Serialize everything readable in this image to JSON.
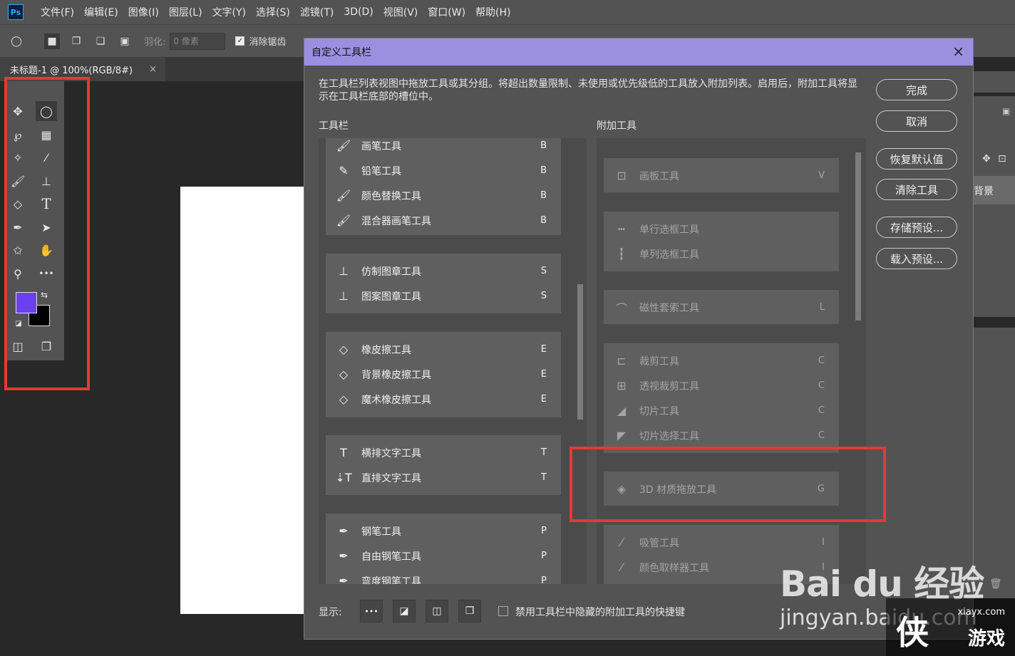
{
  "app": {
    "logo": "Ps",
    "menu": [
      "文件(F)",
      "编辑(E)",
      "图像(I)",
      "图层(L)",
      "文字(Y)",
      "选择(S)",
      "滤镜(T)",
      "3D(D)",
      "视图(V)",
      "窗口(W)",
      "帮助(H)"
    ]
  },
  "options_bar": {
    "feather_label": "羽化:",
    "feather_value": "0 像素",
    "antialias_label": "消除锯齿"
  },
  "document_tab": {
    "title": "未标题-1 @ 100%(RGB/8#)",
    "close": "×"
  },
  "toolbar": {
    "type_tool_glyph": "T",
    "more_glyph": "•••"
  },
  "dialog": {
    "title": "自定义工具栏",
    "close": "×",
    "description": "在工具栏列表视图中拖放工具或其分组。将超出数量限制、未使用或优先级低的工具放入附加列表。启用后，附加工具将显示在工具栏底部的槽位中。",
    "toolbar_title": "工具栏",
    "extra_title": "附加工具",
    "buttons": {
      "done": "完成",
      "cancel": "取消",
      "restore": "恢复默认值",
      "clear": "清除工具",
      "save": "存储预设...",
      "load": "载入预设..."
    },
    "footer": {
      "show_label": "显示:",
      "more_glyph": "•••",
      "checkbox_label": "禁用工具栏中隐藏的附加工具的快捷键"
    },
    "toolbar_groups": [
      {
        "tools": [
          {
            "name": "画笔工具",
            "key": "B",
            "icon": "brush-icon",
            "glyph": "🖌"
          },
          {
            "name": "铅笔工具",
            "key": "B",
            "icon": "pencil-icon",
            "glyph": "✎"
          },
          {
            "name": "颜色替换工具",
            "key": "B",
            "icon": "color-replace-icon",
            "glyph": "🖌"
          },
          {
            "name": "混合器画笔工具",
            "key": "B",
            "icon": "mixer-brush-icon",
            "glyph": "🖌"
          }
        ]
      },
      {
        "tools": [
          {
            "name": "仿制图章工具",
            "key": "S",
            "icon": "clone-stamp-icon",
            "glyph": "⊥"
          },
          {
            "name": "图案图章工具",
            "key": "S",
            "icon": "pattern-stamp-icon",
            "glyph": "⊥"
          }
        ]
      },
      {
        "tools": [
          {
            "name": "橡皮擦工具",
            "key": "E",
            "icon": "eraser-icon",
            "glyph": "◇"
          },
          {
            "name": "背景橡皮擦工具",
            "key": "E",
            "icon": "bg-eraser-icon",
            "glyph": "◇"
          },
          {
            "name": "魔术橡皮擦工具",
            "key": "E",
            "icon": "magic-eraser-icon",
            "glyph": "◇"
          }
        ]
      },
      {
        "tools": [
          {
            "name": "横排文字工具",
            "key": "T",
            "icon": "horizontal-type-icon",
            "glyph": "T"
          },
          {
            "name": "直排文字工具",
            "key": "T",
            "icon": "vertical-type-icon",
            "glyph": "⇣T"
          }
        ]
      },
      {
        "tools": [
          {
            "name": "钢笔工具",
            "key": "P",
            "icon": "pen-icon",
            "glyph": "✒"
          },
          {
            "name": "自由钢笔工具",
            "key": "P",
            "icon": "freeform-pen-icon",
            "glyph": "✒"
          },
          {
            "name": "弯度钢笔工具",
            "key": "P",
            "icon": "curvature-pen-icon",
            "glyph": "✒"
          }
        ]
      }
    ],
    "extra_groups": [
      {
        "tools": [
          {
            "name": "画板工具",
            "key": "V",
            "icon": "artboard-icon",
            "glyph": "⊡"
          }
        ]
      },
      {
        "tools": [
          {
            "name": "单行选框工具",
            "key": "",
            "icon": "single-row-marquee-icon",
            "glyph": "┅"
          },
          {
            "name": "单列选框工具",
            "key": "",
            "icon": "single-column-marquee-icon",
            "glyph": "┇"
          }
        ]
      },
      {
        "tools": [
          {
            "name": "磁性套索工具",
            "key": "L",
            "icon": "magnetic-lasso-icon",
            "glyph": "⌒"
          }
        ]
      },
      {
        "tools": [
          {
            "name": "裁剪工具",
            "key": "C",
            "icon": "crop-icon",
            "glyph": "⊏"
          },
          {
            "name": "透视裁剪工具",
            "key": "C",
            "icon": "perspective-crop-icon",
            "glyph": "⊞"
          },
          {
            "name": "切片工具",
            "key": "C",
            "icon": "slice-icon",
            "glyph": "◢"
          },
          {
            "name": "切片选择工具",
            "key": "C",
            "icon": "slice-select-icon",
            "glyph": "◤"
          }
        ]
      },
      {
        "tools": [
          {
            "name": "3D 材质拖放工具",
            "key": "G",
            "icon": "3d-material-drop-icon",
            "glyph": "◈"
          }
        ]
      },
      {
        "tools": [
          {
            "name": "吸管工具",
            "key": "I",
            "icon": "eyedropper-icon",
            "glyph": "⁄"
          },
          {
            "name": "颜色取样器工具",
            "key": "I",
            "icon": "color-sampler-icon",
            "glyph": "⁄"
          }
        ]
      }
    ]
  },
  "right_panel": {
    "layer_name": "背景"
  },
  "watermark": {
    "baidu_text": "Bai du 经验",
    "baidu_url": "jingyan.baidu.com",
    "site": "xiayx.com",
    "big_char": "侠",
    "small_text": "游戏"
  }
}
